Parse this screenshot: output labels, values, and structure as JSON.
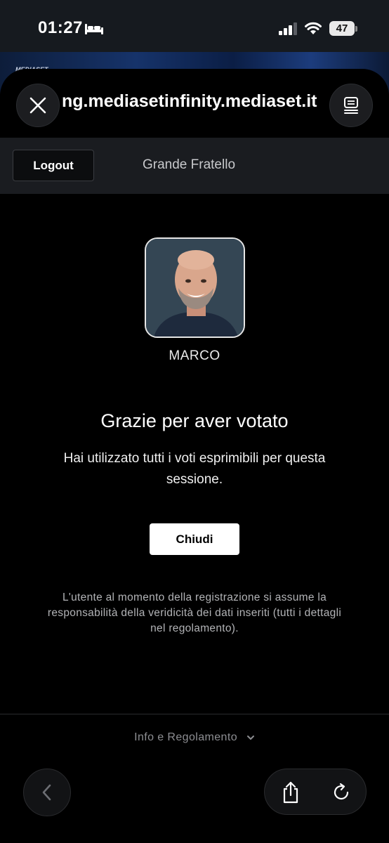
{
  "status_bar": {
    "time": "01:27",
    "battery": "47",
    "icons": [
      "bed-icon",
      "signal-icon",
      "wifi-icon",
      "battery-icon"
    ]
  },
  "backdrop": {
    "logo_text": "MEDIASET"
  },
  "browser": {
    "url": "ng.mediasetinfinity.mediaset.it",
    "icons": [
      "close-icon",
      "tabs-icon"
    ]
  },
  "header": {
    "logout_label": "Logout",
    "show_title": "Grande Fratello"
  },
  "vote": {
    "contestant_name": "MARCO",
    "title": "Grazie per aver votato",
    "message": "Hai utilizzato tutti i voti esprimibili per questa sessione.",
    "close_label": "Chiudi",
    "disclaimer": "L'utente al momento della registrazione si assume la responsabilità della veridicità dei dati inseriti (tutti i dettagli nel regolamento)."
  },
  "footer": {
    "info_label": "Info e Regolamento",
    "icons": [
      "chevron-down-icon"
    ]
  },
  "toolbar": {
    "icons": [
      "back-arrow-icon",
      "share-icon",
      "reload-icon"
    ]
  },
  "colors": {
    "background": "#000000",
    "header_bg": "#1a1c20",
    "primary_button_bg": "#ffffff",
    "muted_text": "#8d8e92"
  }
}
